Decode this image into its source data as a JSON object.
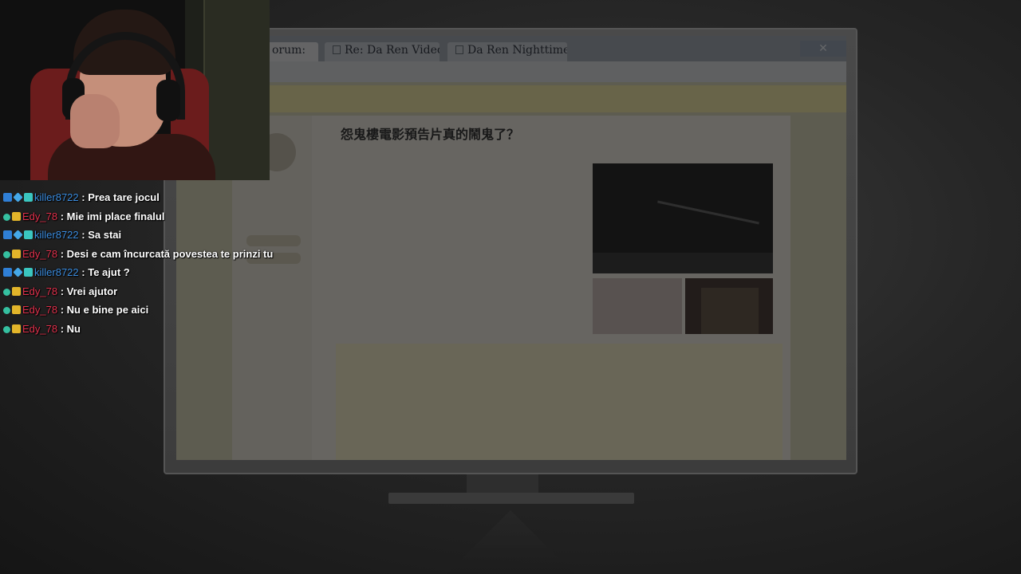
{
  "browser": {
    "tabs": [
      {
        "label": "orum:"
      },
      {
        "label": "Re: Da Ren Video I"
      },
      {
        "label": "Da Ren Nighttime"
      }
    ],
    "close_label": "✕"
  },
  "forum": {
    "post_title": "怨鬼樓電影預告片真的鬧鬼了？"
  },
  "colors": {
    "user_killer": "#3b8de0",
    "user_edy": "#e0314c",
    "chat_text": "#ffffff"
  },
  "chat": {
    "messages": [
      {
        "user": "killer8722",
        "text": ": Prea tare jocul",
        "badges": [
          "prime",
          "cube",
          "grid"
        ],
        "color": "#3b8de0"
      },
      {
        "user": "Edy_78",
        "text": ": Mie imi place finalul",
        "badges": [
          "dot",
          "crown"
        ],
        "color": "#e0314c"
      },
      {
        "user": "killer8722",
        "text": ": Sa stai",
        "badges": [
          "prime",
          "cube",
          "grid"
        ],
        "color": "#3b8de0"
      },
      {
        "user": "Edy_78",
        "text": ": Desi e cam încurcată povestea te prinzi tu",
        "badges": [
          "dot",
          "crown"
        ],
        "color": "#e0314c"
      },
      {
        "user": "killer8722",
        "text": ": Te ajut ?",
        "badges": [
          "prime",
          "cube",
          "grid"
        ],
        "color": "#3b8de0"
      },
      {
        "user": "Edy_78",
        "text": ": Vrei ajutor",
        "badges": [
          "dot",
          "crown"
        ],
        "color": "#e0314c"
      },
      {
        "user": "Edy_78",
        "text": ": Nu e bine pe aici",
        "badges": [
          "dot",
          "crown"
        ],
        "color": "#e0314c"
      },
      {
        "user": "Edy_78",
        "text": ": Nu",
        "badges": [
          "dot",
          "crown"
        ],
        "color": "#e0314c"
      }
    ]
  }
}
